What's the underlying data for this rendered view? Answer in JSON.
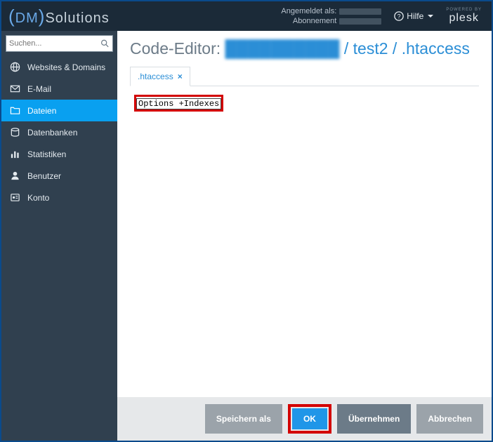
{
  "brand": {
    "dm": "DM",
    "rest": "Solutions"
  },
  "topbar": {
    "logged_in": "Angemeldet als:",
    "subscription": "Abonnement",
    "help_label": "Hilfe",
    "powered_by": "POWERED BY",
    "plesk": "plesk"
  },
  "search": {
    "placeholder": "Suchen..."
  },
  "nav": [
    {
      "key": "websites",
      "label": "Websites & Domains"
    },
    {
      "key": "email",
      "label": "E-Mail"
    },
    {
      "key": "files",
      "label": "Dateien",
      "active": true
    },
    {
      "key": "db",
      "label": "Datenbanken"
    },
    {
      "key": "stats",
      "label": "Statistiken"
    },
    {
      "key": "users",
      "label": "Benutzer"
    },
    {
      "key": "account",
      "label": "Konto"
    }
  ],
  "main": {
    "editor_label": "Code-Editor:",
    "path_hidden": "██████████",
    "path_sep1": " / ",
    "path_dir": "test2",
    "path_sep2": " / ",
    "path_file": ".htaccess",
    "tab_label": ".htaccess",
    "tab_close": "×",
    "code": "Options +Indexes"
  },
  "buttons": {
    "save_as": "Speichern als",
    "ok": "OK",
    "apply": "Übernehmen",
    "cancel": "Abbrechen"
  }
}
